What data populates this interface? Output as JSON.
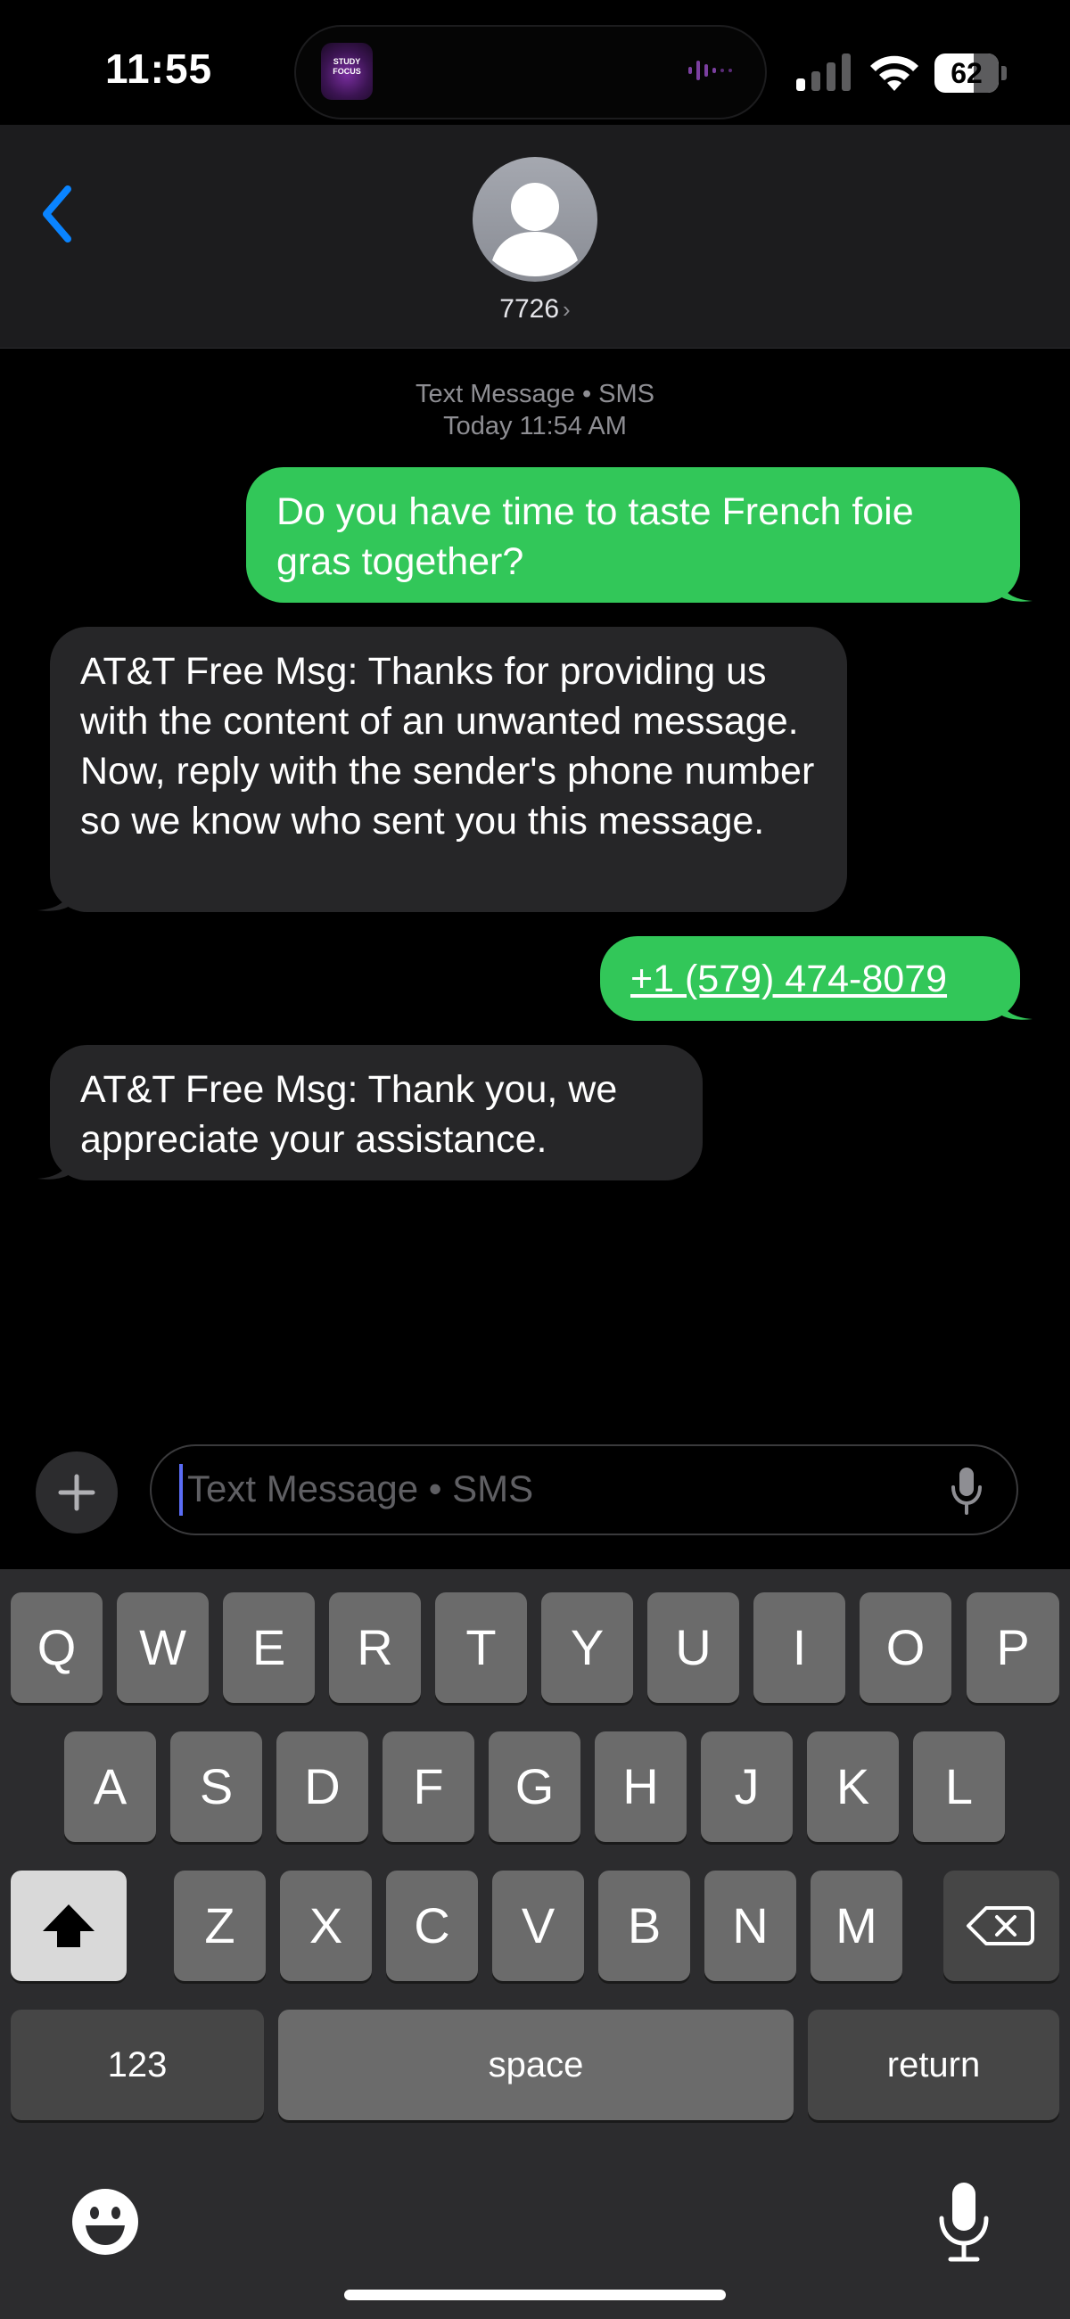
{
  "status": {
    "time": "11:55",
    "battery": "62",
    "island_art_text": "STUDY FOCUS"
  },
  "header": {
    "contact": "7726",
    "chevron": "›"
  },
  "conversation": {
    "service": "Text Message • SMS",
    "timestamp": "Today 11:54 AM",
    "messages": [
      {
        "direction": "sent",
        "text": "Do you have time to taste French foie gras together?"
      },
      {
        "direction": "received",
        "text": "AT&T Free Msg: Thanks for providing us with the content of an unwanted message. Now, reply with the sender's phone number so we know who sent you this message."
      },
      {
        "direction": "sent",
        "text": "+1 (579) 474-8079"
      },
      {
        "direction": "received",
        "text": "AT&T Free Msg: Thank you, we appreciate your assistance."
      }
    ]
  },
  "composer": {
    "placeholder": "Text Message • SMS"
  },
  "keyboard": {
    "row1": [
      "Q",
      "W",
      "E",
      "R",
      "T",
      "Y",
      "U",
      "I",
      "O",
      "P"
    ],
    "row2": [
      "A",
      "S",
      "D",
      "F",
      "G",
      "H",
      "J",
      "K",
      "L"
    ],
    "row3": [
      "Z",
      "X",
      "C",
      "V",
      "B",
      "N",
      "M"
    ],
    "numbers": "123",
    "space": "space",
    "return": "return"
  },
  "colors": {
    "sent_bubble": "#32c759",
    "received_bubble": "#262628",
    "link_blue": "#0a84ff"
  },
  "icons": {
    "back": "chevron-left-icon",
    "add": "plus-icon",
    "mic": "microphone-icon",
    "shift": "shift-arrow-icon",
    "delete": "backspace-icon",
    "emoji": "emoji-icon"
  }
}
